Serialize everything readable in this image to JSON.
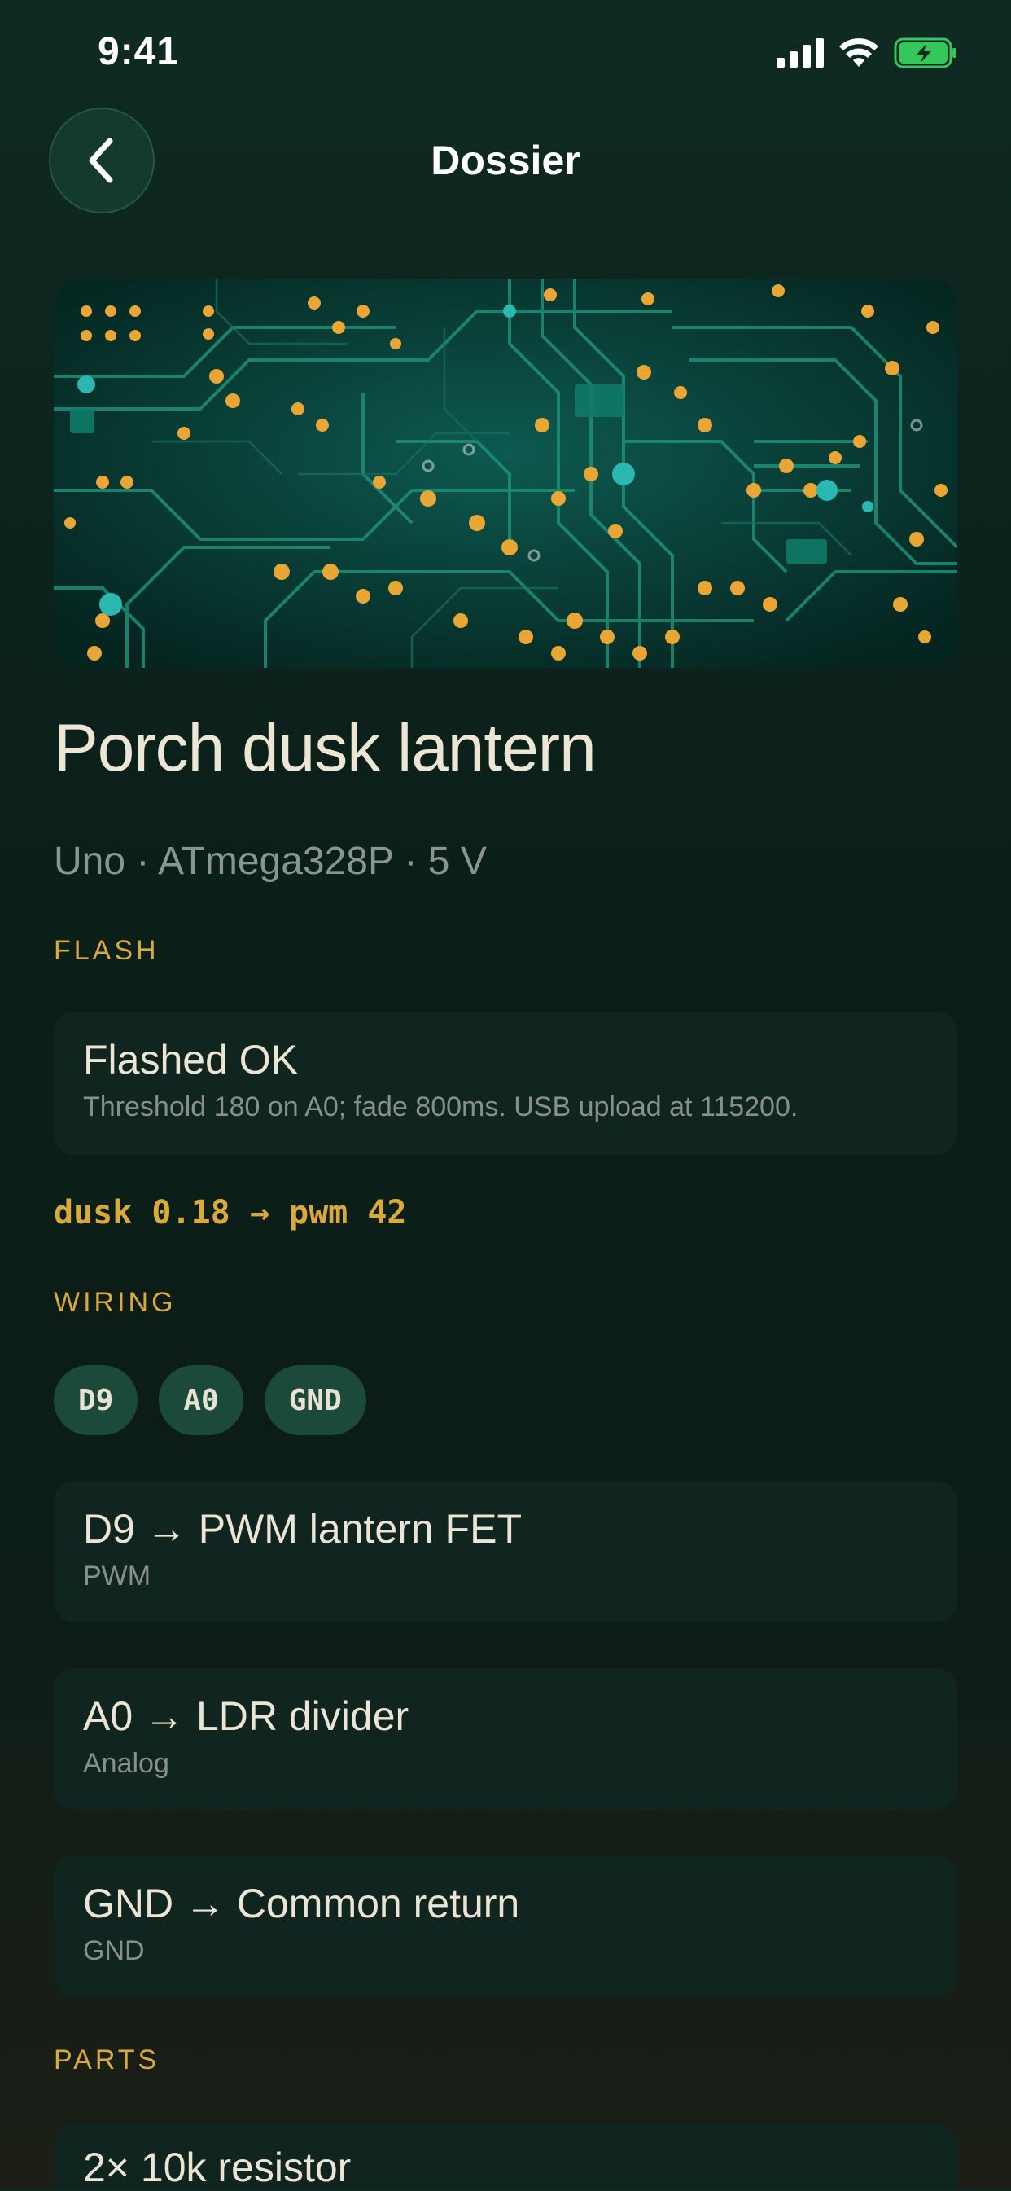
{
  "status": {
    "time": "9:41",
    "icons": [
      "signal-icon",
      "wifi-icon",
      "battery-charging-icon"
    ]
  },
  "nav": {
    "title": "Dossier",
    "back_icon": "chevron-left-icon"
  },
  "project": {
    "title": "Porch dusk lantern",
    "subtitle": "Uno · ATmega328P · 5 V"
  },
  "flash": {
    "section_label": "FLASH",
    "status_title": "Flashed OK",
    "status_detail": "Threshold 180 on A0; fade 800ms. USB upload at 115200.",
    "readout": "dusk 0.18 → pwm 42"
  },
  "wiring": {
    "section_label": "WIRING",
    "chips": [
      "D9",
      "A0",
      "GND"
    ],
    "items": [
      {
        "title": "D9 → PWM lantern FET",
        "type": "PWM"
      },
      {
        "title": "A0 → LDR divider",
        "type": "Analog"
      },
      {
        "title": "GND → Common return",
        "type": "GND"
      }
    ]
  },
  "parts": {
    "section_label": "PARTS",
    "items": [
      {
        "title": "2× 10k resistor"
      }
    ]
  },
  "colors": {
    "accent": "#d9a93c",
    "card": "#112520",
    "chip": "#1b4a3b",
    "battery": "#34c759"
  }
}
